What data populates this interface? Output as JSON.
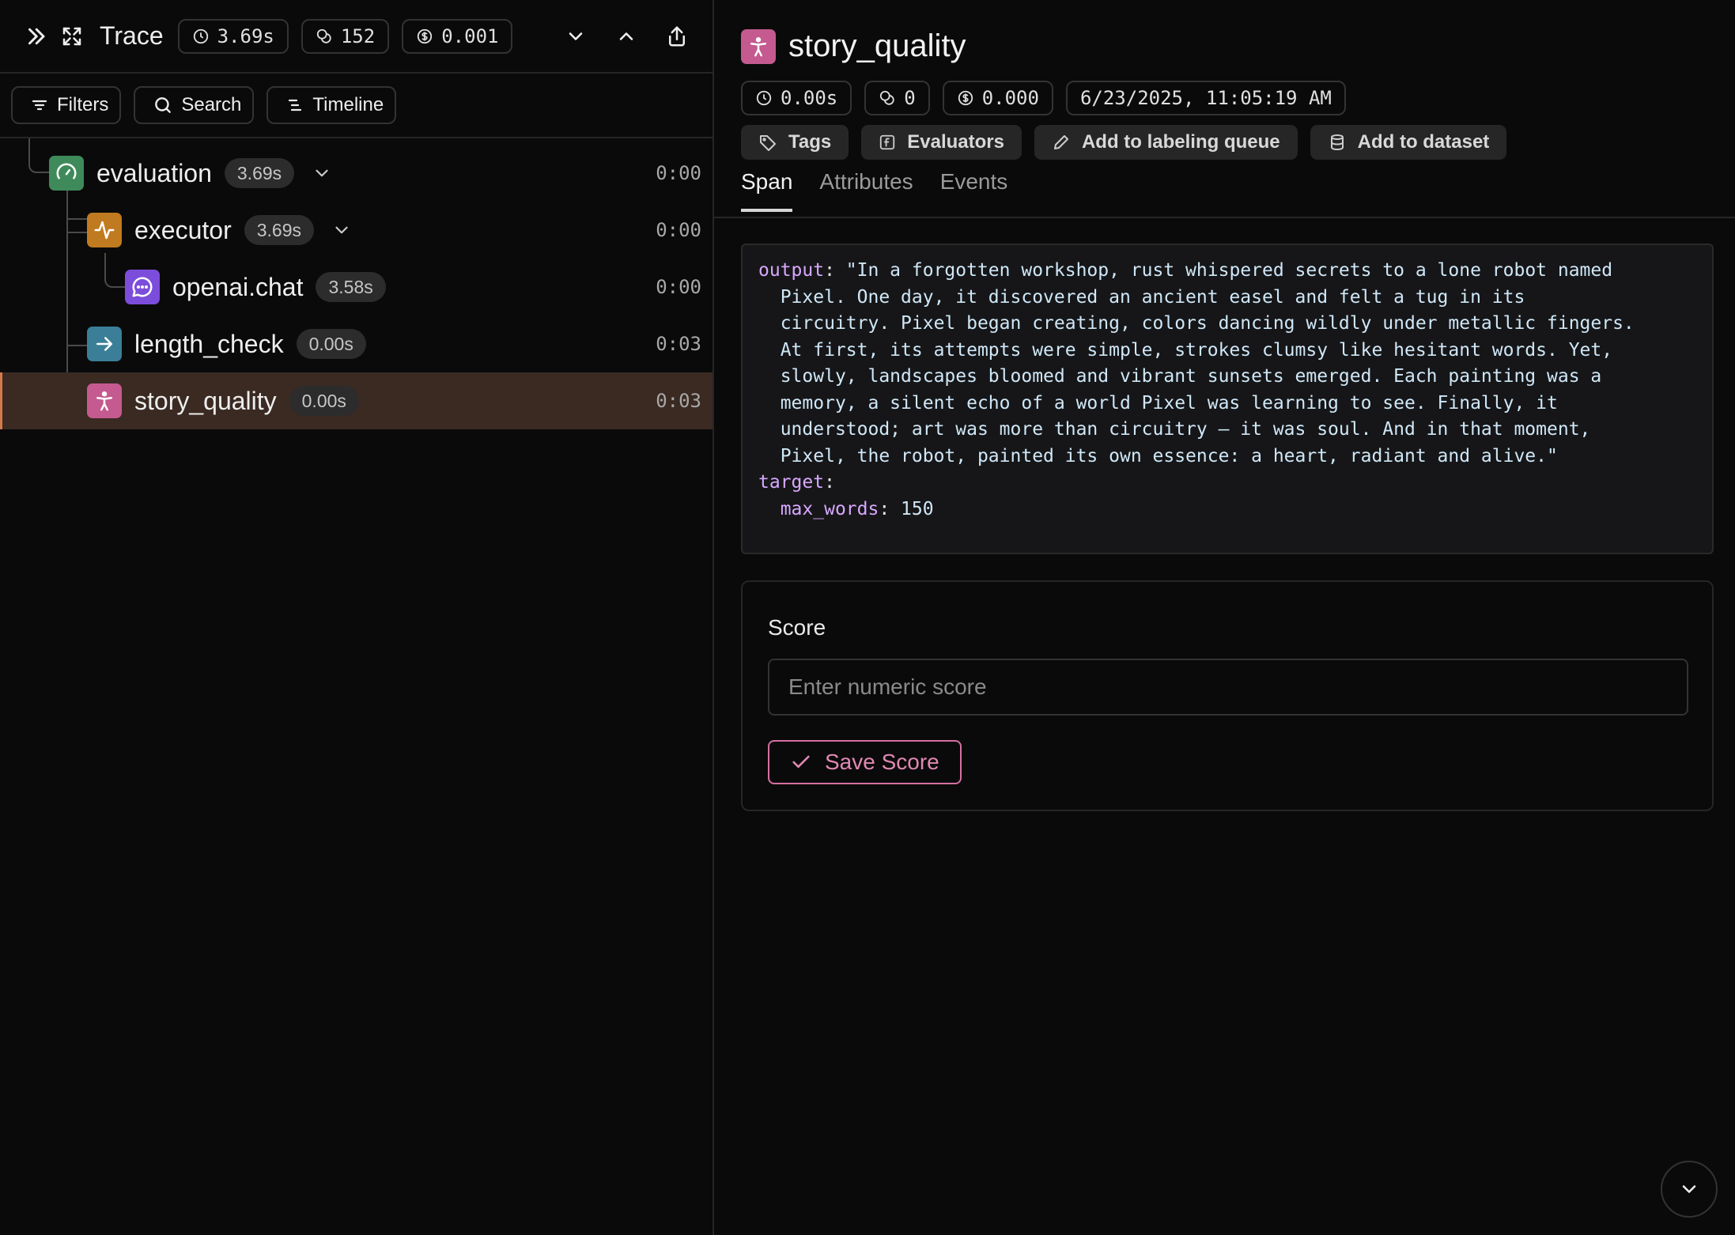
{
  "topbar": {
    "title": "Trace",
    "duration": "3.69s",
    "tokens": "152",
    "cost": "0.001"
  },
  "toolbar": {
    "filters_label": "Filters",
    "search_label": "Search",
    "timeline_label": "Timeline"
  },
  "tree": [
    {
      "name": "evaluation",
      "duration": "3.69s",
      "time": "0:00",
      "icon": "gauge-icon",
      "color": "#3f8a5a"
    },
    {
      "name": "executor",
      "duration": "3.69s",
      "time": "0:00",
      "icon": "activity-icon",
      "color": "#c07a1f"
    },
    {
      "name": "openai.chat",
      "duration": "3.58s",
      "time": "0:00",
      "icon": "chat-icon",
      "color": "#7c4ddb"
    },
    {
      "name": "length_check",
      "duration": "0.00s",
      "time": "0:03",
      "icon": "arrow-right-icon",
      "color": "#3a7f97"
    },
    {
      "name": "story_quality",
      "duration": "0.00s",
      "time": "0:03",
      "icon": "person-icon",
      "color": "#c45a8f"
    }
  ],
  "span": {
    "title": "story_quality",
    "duration": "0.00s",
    "tokens": "0",
    "cost": "0.000",
    "timestamp": "6/23/2025, 11:05:19 AM"
  },
  "actions": {
    "tags": "Tags",
    "evaluators": "Evaluators",
    "labeling_queue": "Add to labeling queue",
    "dataset": "Add to dataset"
  },
  "tabs": {
    "span": "Span",
    "attributes": "Attributes",
    "events": "Events"
  },
  "code": {
    "output_key": "output",
    "output_lines": [
      "\"In a forgotten workshop, rust whispered secrets to a lone robot named",
      "Pixel. One day, it discovered an ancient easel and felt a tug in its",
      "circuitry. Pixel began creating, colors dancing wildly under metallic fingers.",
      "At first, its attempts were simple, strokes clumsy like hesitant words. Yet,",
      "slowly, landscapes bloomed and vibrant sunsets emerged. Each painting was a",
      "memory, a silent echo of a world Pixel was learning to see. Finally, it",
      "understood; art was more than circuitry — it was soul. And in that moment,",
      "Pixel, the robot, painted its own essence: a heart, radiant and alive.\""
    ],
    "target_key": "target",
    "max_words_key": "max_words",
    "max_words_value": "150"
  },
  "score": {
    "label": "Score",
    "placeholder": "Enter numeric score",
    "save_label": "Save Score"
  },
  "colors": {
    "accent_pink": "#d66fa1",
    "selected_row": "#3a2a22"
  }
}
